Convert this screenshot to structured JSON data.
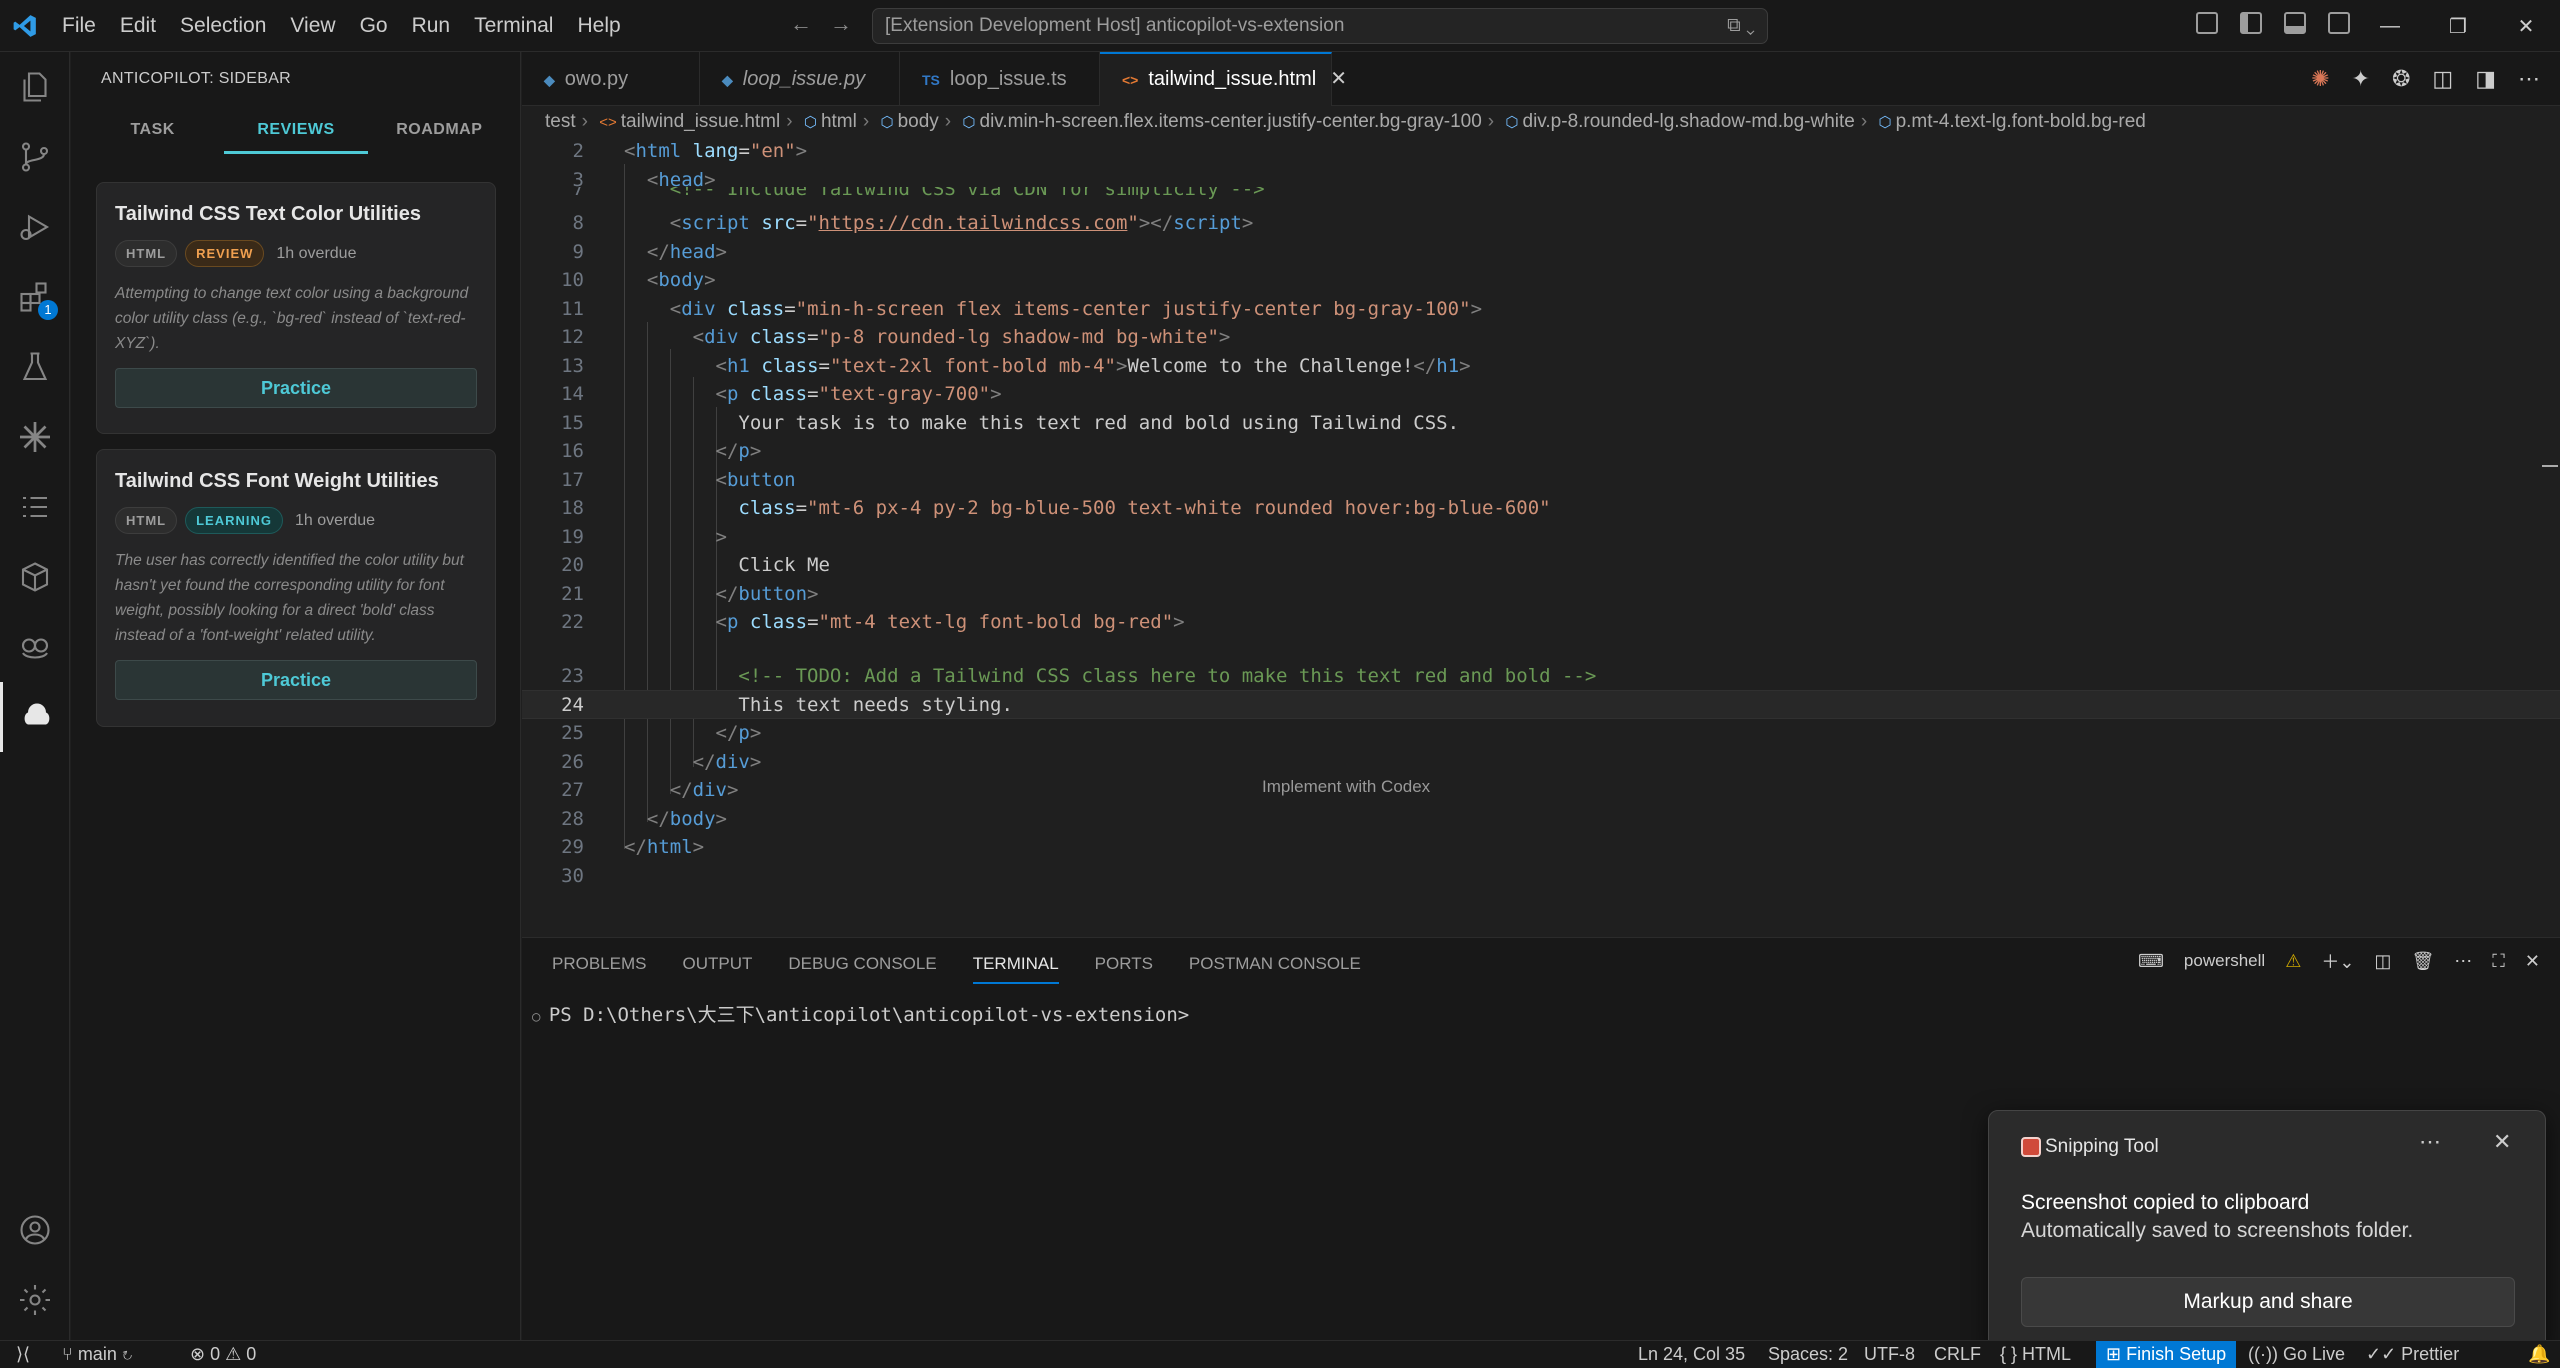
{
  "titlebar": {
    "menu": [
      "File",
      "Edit",
      "Selection",
      "View",
      "Go",
      "Run",
      "Terminal",
      "Help"
    ],
    "command_center": "[Extension Development Host] anticopilot-vs-extension"
  },
  "activitybar": {
    "extensions_badge": "1"
  },
  "sidebar": {
    "title": "ANTICOPILOT: SIDEBAR",
    "tabs": [
      "TASK",
      "REVIEWS",
      "ROADMAP"
    ],
    "cards": [
      {
        "title": "Tailwind CSS Text Color Utilities",
        "tag1": "HTML",
        "tag2": "REVIEW",
        "overdue": "1h overdue",
        "description": "Attempting to change text color using a background color utility class (e.g., `bg-red` instead of `text-red-XYZ`).",
        "button": "Practice"
      },
      {
        "title": "Tailwind CSS Font Weight Utilities",
        "tag1": "HTML",
        "tag2": "LEARNING",
        "overdue": "1h overdue",
        "description": "The user has correctly identified the color utility but hasn't yet found the corresponding utility for font weight, possibly looking for a direct 'bold' class instead of a 'font-weight' related utility.",
        "button": "Practice"
      }
    ]
  },
  "editor_tabs": [
    {
      "label": "owo.py",
      "icon": "python-file-icon"
    },
    {
      "label": "loop_issue.py",
      "icon": "python-file-icon"
    },
    {
      "label": "loop_issue.ts",
      "icon": "typescript-file-icon",
      "prefix": "TS"
    },
    {
      "label": "tailwind_issue.html",
      "icon": "html-file-icon"
    }
  ],
  "breadcrumb": [
    "test",
    "tailwind_issue.html",
    "html",
    "body",
    "div.min-h-screen.flex.items-center.justify-center.bg-gray-100",
    "div.p-8.rounded-lg.shadow-md.bg-white",
    "p.mt-4.text-lg.font-bold.bg-red"
  ],
  "code": {
    "line_numbers": [
      "2",
      "3",
      "7",
      "8",
      "9",
      "10",
      "11",
      "12",
      "13",
      "14",
      "15",
      "16",
      "17",
      "18",
      "19",
      "20",
      "21",
      "22",
      "23",
      "24",
      "25",
      "26",
      "27",
      "28",
      "29",
      "30"
    ],
    "codelens": "Implement with Codex",
    "current_line": "24"
  },
  "panel": {
    "tabs": [
      "PROBLEMS",
      "OUTPUT",
      "DEBUG CONSOLE",
      "TERMINAL",
      "PORTS",
      "POSTMAN CONSOLE"
    ],
    "shell": "powershell",
    "terminal_prompt": "PS D:\\Others\\大三下\\anticopilot\\anticopilot-vs-extension>"
  },
  "statusbar": {
    "branch": "main",
    "errors": "0",
    "warnings": "0",
    "position": "Ln 24, Col 35",
    "spaces": "Spaces: 2",
    "encoding": "UTF-8",
    "eol": "CRLF",
    "language": "HTML",
    "finish_setup": "Finish Setup",
    "go_live": "Go Live",
    "prettier": "Prettier"
  },
  "toast": {
    "app": "Snipping Tool",
    "title": "Screenshot copied to clipboard",
    "body": "Automatically saved to screenshots folder.",
    "button": "Markup and share"
  }
}
